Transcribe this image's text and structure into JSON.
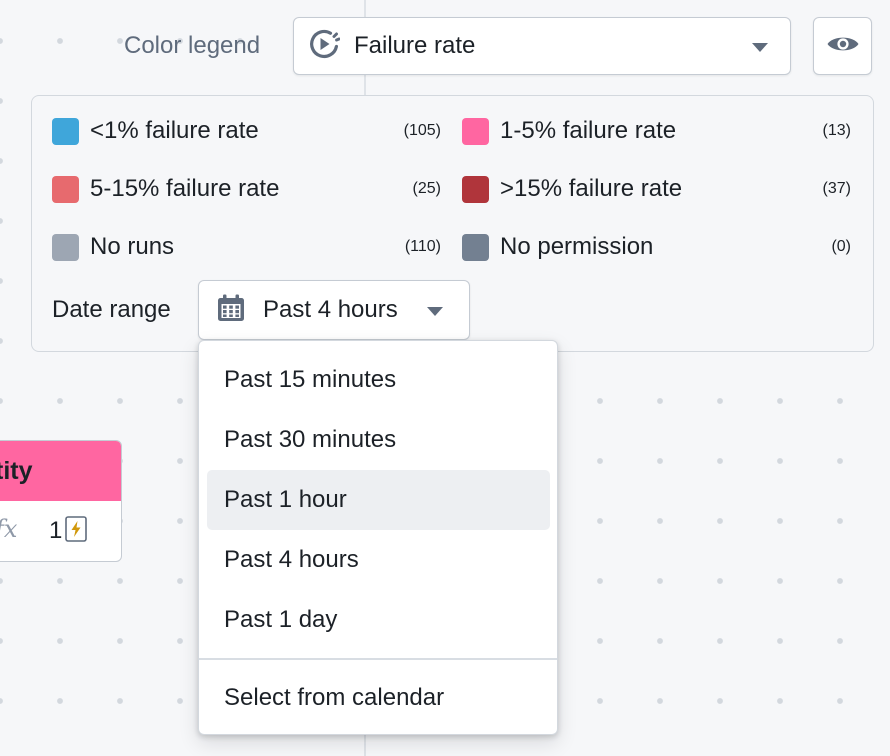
{
  "header": {
    "color_legend_label": "Color legend",
    "color_legend_value": "Failure rate",
    "color_legend_icon": "play-history-icon",
    "visibility_icon": "eye-icon"
  },
  "legend": {
    "items": [
      {
        "label": "<1% failure rate",
        "count": "(105)",
        "color": "#3fa6da"
      },
      {
        "label": "1-5% failure rate",
        "count": "(13)",
        "color": "#ff66a1"
      },
      {
        "label": "5-15% failure rate",
        "count": "(25)",
        "color": "#e76a6e"
      },
      {
        "label": ">15% failure rate",
        "count": "(37)",
        "color": "#b0353b"
      },
      {
        "label": "No runs",
        "count": "(110)",
        "color": "#9da6b3"
      },
      {
        "label": "No permission",
        "count": "(0)",
        "color": "#738091"
      }
    ],
    "date_range_label": "Date range",
    "date_range_value": "Past 4 hours",
    "date_range_icon": "calendar-icon"
  },
  "node_card": {
    "title": "tity",
    "formula_symbol": "fx",
    "count": "1",
    "header_color": "#ff66a1"
  },
  "date_menu": {
    "options": [
      {
        "label": "Past 15 minutes"
      },
      {
        "label": "Past 30 minutes"
      },
      {
        "label": "Past 1 hour",
        "hovered": true
      },
      {
        "label": "Past 4 hours"
      },
      {
        "label": "Past 1 day"
      }
    ],
    "calendar_option": "Select from calendar"
  }
}
